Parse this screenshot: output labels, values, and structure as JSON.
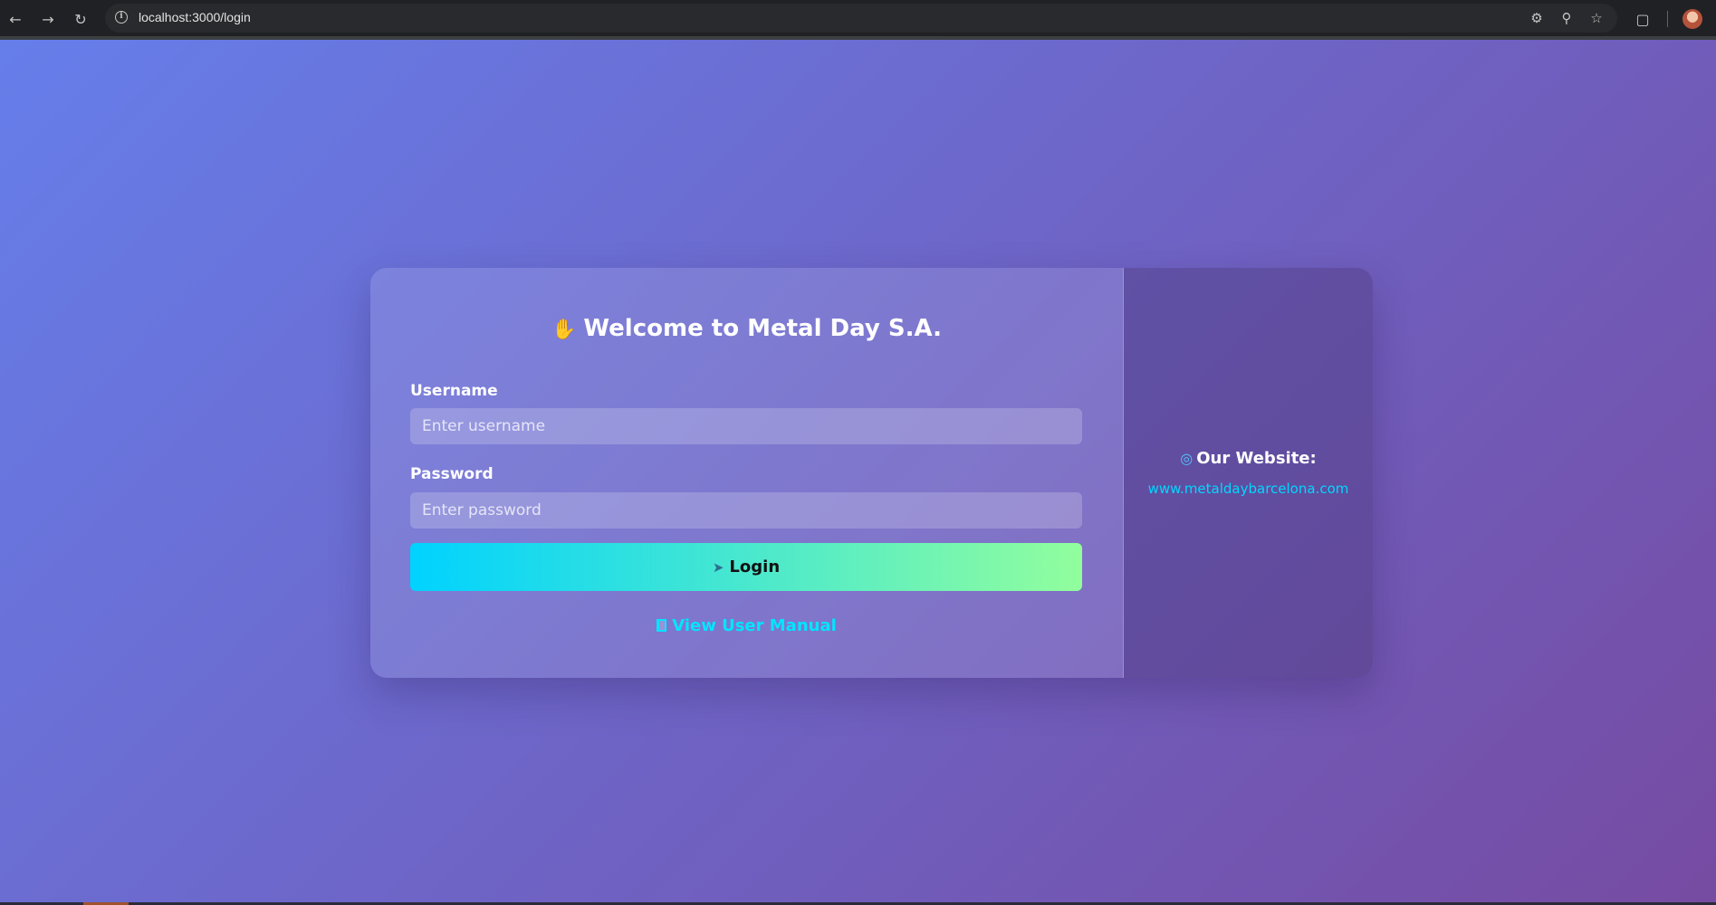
{
  "browser": {
    "url": "localhost:3000/login",
    "icons": {
      "back": "arrow-left-icon",
      "forward": "arrow-right-icon",
      "reload": "reload-icon",
      "site_info": "info-icon",
      "password": "key-icon",
      "zoom": "zoom-icon",
      "bookmark": "star-icon",
      "extensions": "puzzle-icon"
    }
  },
  "login": {
    "title": "Welcome to Metal Day S.A.",
    "title_icon": "waving-hand-icon",
    "username_label": "Username",
    "username_placeholder": "Enter username",
    "username_value": "",
    "password_label": "Password",
    "password_placeholder": "Enter password",
    "password_value": "",
    "login_button": "Login",
    "login_icon": "rocket-icon",
    "manual_link": "View User Manual",
    "manual_icon": "book-icon"
  },
  "sidebar": {
    "website_heading": "Our Website:",
    "website_icon": "globe-icon",
    "website_link": "www.metaldaybarcelona.com"
  },
  "colors": {
    "background_start": "#667eea",
    "background_end": "#764ba2",
    "button_start": "#00d2ff",
    "button_end": "#92fe9d",
    "link": "#00e5ff"
  }
}
